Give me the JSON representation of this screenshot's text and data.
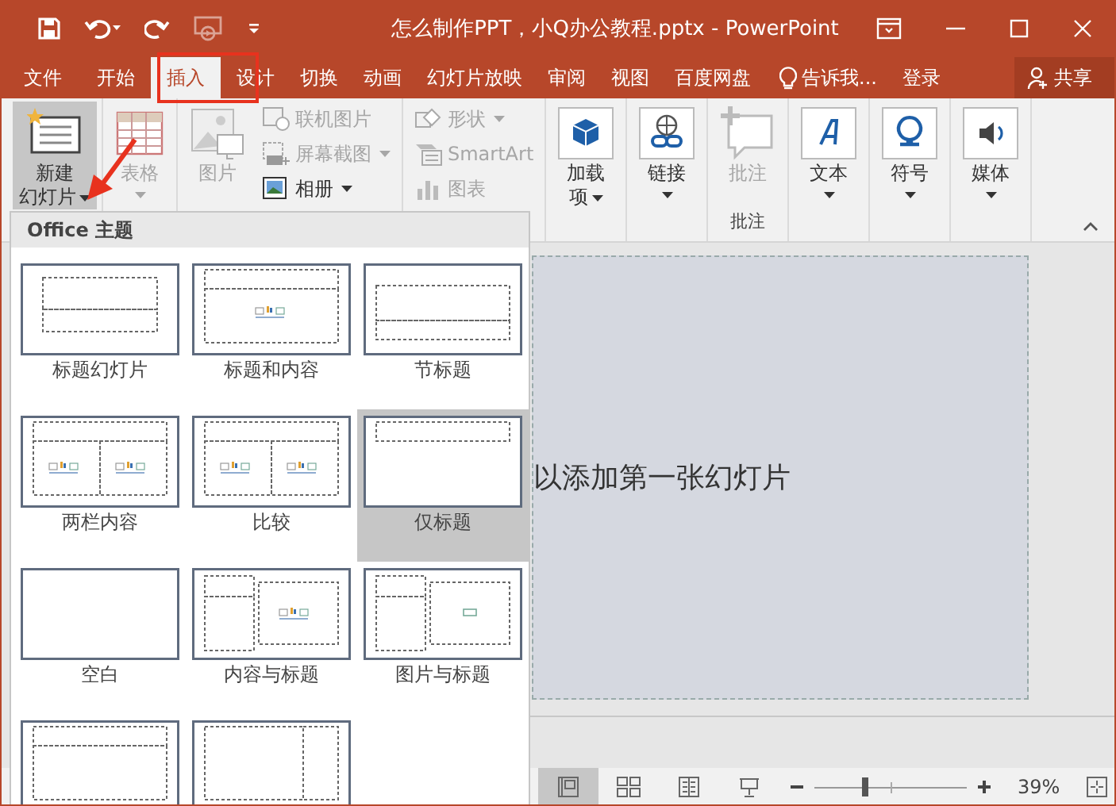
{
  "title_bar": {
    "title": "怎么制作PPT，小Q办公教程.pptx - PowerPoint"
  },
  "menu_tabs": [
    {
      "label": "文件",
      "selected": false
    },
    {
      "label": "开始",
      "selected": false
    },
    {
      "label": "插入",
      "selected": true
    },
    {
      "label": "设计",
      "selected": false
    },
    {
      "label": "切换",
      "selected": false
    },
    {
      "label": "动画",
      "selected": false
    },
    {
      "label": "幻灯片放映",
      "selected": false
    },
    {
      "label": "审阅",
      "selected": false
    },
    {
      "label": "视图",
      "selected": false
    },
    {
      "label": "百度网盘",
      "selected": false
    }
  ],
  "tell_me": "告诉我...",
  "login": "登录",
  "share": "共享",
  "ribbon": {
    "groups": [
      {
        "items": [
          {
            "kind": "large",
            "lines": [
              "新建",
              "幻灯片"
            ],
            "dropdown": true,
            "disabled": false,
            "pressed": true
          }
        ]
      },
      {
        "items": [
          {
            "kind": "large",
            "lines": [
              "表格"
            ],
            "dropdown": true,
            "disabled": true
          }
        ]
      },
      {
        "items": [
          {
            "kind": "large",
            "lines": [
              "图片"
            ],
            "dropdown": false,
            "disabled": true
          },
          {
            "kind": "small",
            "lines": [
              "联机图片"
            ],
            "dropdown": false,
            "disabled": true
          },
          {
            "kind": "small",
            "lines": [
              "屏幕截图"
            ],
            "dropdown": true,
            "disabled": true
          },
          {
            "kind": "small",
            "lines": [
              "相册"
            ],
            "dropdown": true,
            "disabled": false
          }
        ]
      },
      {
        "items": [
          {
            "kind": "small",
            "lines": [
              "形状"
            ],
            "dropdown": true,
            "disabled": true
          },
          {
            "kind": "small",
            "lines": [
              "SmartArt"
            ],
            "dropdown": false,
            "disabled": true
          },
          {
            "kind": "small",
            "lines": [
              "图表"
            ],
            "dropdown": false,
            "disabled": true
          }
        ]
      },
      {
        "items": [
          {
            "kind": "large",
            "lines": [
              "加载",
              "项"
            ],
            "dropdown": true,
            "disabled": false
          }
        ]
      },
      {
        "items": [
          {
            "kind": "large",
            "lines": [
              "链接"
            ],
            "dropdown": true,
            "disabled": false
          }
        ]
      },
      {
        "label": "批注",
        "items": [
          {
            "kind": "large",
            "lines": [
              "批注"
            ],
            "dropdown": false,
            "disabled": true
          }
        ]
      },
      {
        "items": [
          {
            "kind": "large",
            "lines": [
              "文本"
            ],
            "dropdown": true,
            "disabled": false
          }
        ]
      },
      {
        "items": [
          {
            "kind": "large",
            "lines": [
              "符号"
            ],
            "dropdown": true,
            "disabled": false
          }
        ]
      },
      {
        "items": [
          {
            "kind": "large",
            "lines": [
              "媒体"
            ],
            "dropdown": true,
            "disabled": false
          }
        ]
      }
    ]
  },
  "layout_gallery": {
    "header": "Office 主题",
    "layouts": [
      {
        "kind": "title",
        "label": "标题幻灯片",
        "selected": false
      },
      {
        "kind": "title-content",
        "label": "标题和内容",
        "selected": false
      },
      {
        "kind": "section",
        "label": "节标题",
        "selected": false
      },
      {
        "kind": "two-content",
        "label": "两栏内容",
        "selected": false
      },
      {
        "kind": "comparison",
        "label": "比较",
        "selected": false
      },
      {
        "kind": "title-only",
        "label": "仅标题",
        "selected": true
      },
      {
        "kind": "blank",
        "label": "空白",
        "selected": false
      },
      {
        "kind": "content-caption",
        "label": "内容与标题",
        "selected": false
      },
      {
        "kind": "picture-caption",
        "label": "图片与标题",
        "selected": false
      },
      {
        "kind": "vertical-text",
        "selected": false
      },
      {
        "kind": "vertical-title",
        "selected": false
      }
    ]
  },
  "slide": {
    "placeholder": "以添加第一张幻灯片"
  },
  "status_bar": {
    "views": [
      {
        "selected": true
      },
      {
        "selected": false
      },
      {
        "selected": false
      },
      {
        "selected": false
      }
    ],
    "zoom_slider": {
      "level": 0.33
    },
    "zoom": "39%"
  }
}
